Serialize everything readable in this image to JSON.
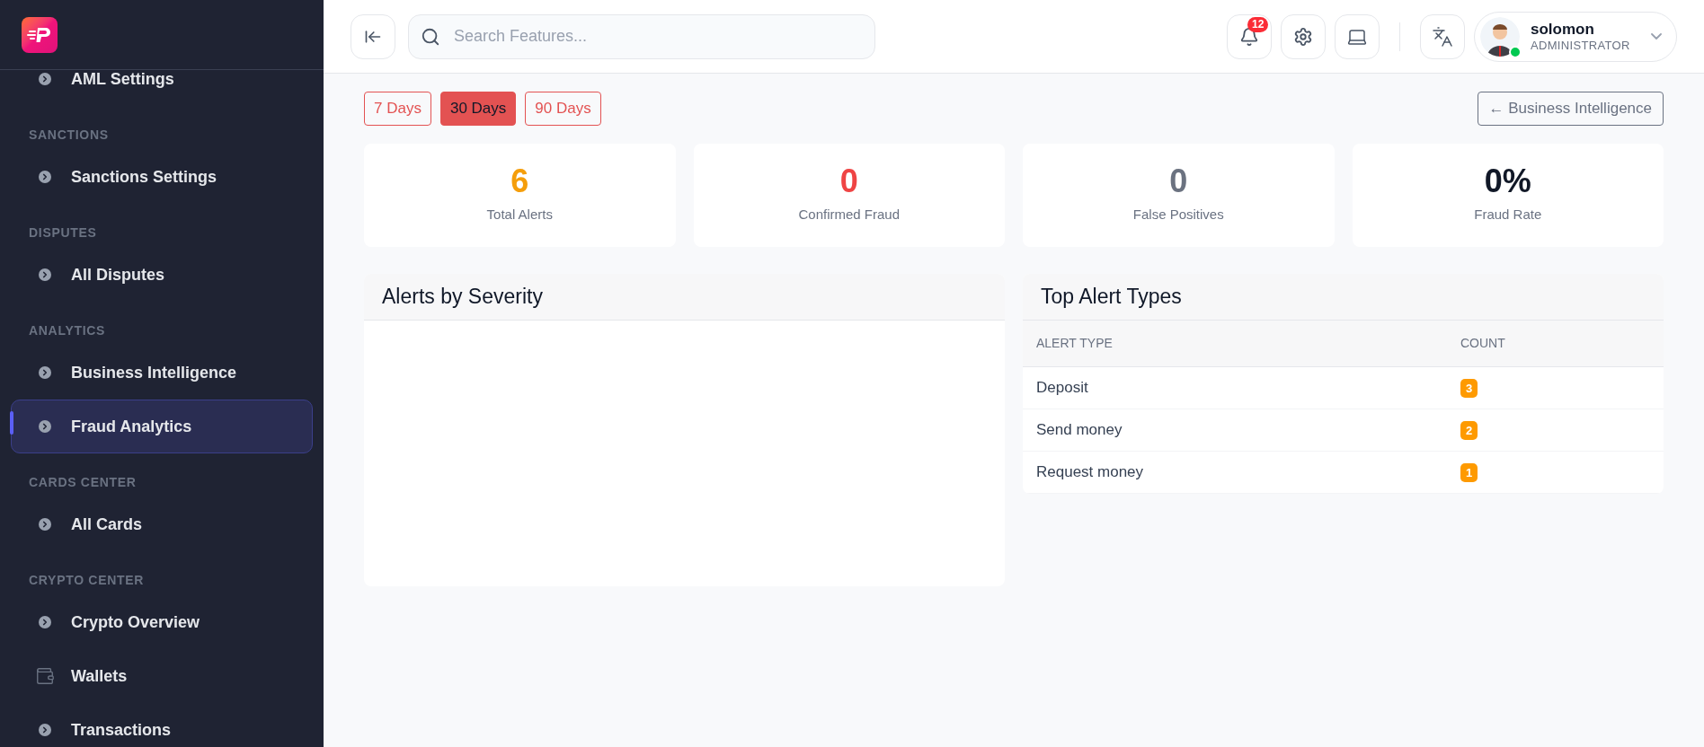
{
  "sidebar": {
    "sections": [
      {
        "items": [
          {
            "label": "AML Settings",
            "kind": "chevron",
            "selected": false
          }
        ]
      },
      {
        "heading": "SANCTIONS",
        "items": [
          {
            "label": "Sanctions Settings",
            "kind": "chevron",
            "selected": false
          }
        ]
      },
      {
        "heading": "DISPUTES",
        "items": [
          {
            "label": "All Disputes",
            "kind": "chevron",
            "selected": false
          }
        ]
      },
      {
        "heading": "ANALYTICS",
        "items": [
          {
            "label": "Business Intelligence",
            "kind": "chevron",
            "selected": false
          },
          {
            "label": "Fraud Analytics",
            "kind": "chevron",
            "selected": true
          }
        ]
      },
      {
        "heading": "CARDS CENTER",
        "items": [
          {
            "label": "All Cards",
            "kind": "chevron",
            "selected": false
          }
        ]
      },
      {
        "heading": "CRYPTO CENTER",
        "items": [
          {
            "label": "Crypto Overview",
            "kind": "chevron",
            "selected": false
          },
          {
            "label": "Wallets",
            "kind": "wallet",
            "selected": false
          },
          {
            "label": "Transactions",
            "kind": "chevron",
            "selected": false
          }
        ]
      }
    ]
  },
  "topbar": {
    "search": {
      "placeholder": "Search Features..."
    },
    "notifications": "12",
    "user": {
      "name": "solomon",
      "role": "ADMINISTRATOR",
      "online": true
    }
  },
  "filters": [
    {
      "label": "7 Days",
      "selected": false
    },
    {
      "label": "30 Days",
      "selected": true
    },
    {
      "label": "90 Days",
      "selected": false
    }
  ],
  "back_button": "← Business Intelligence",
  "stats": [
    {
      "value": "6",
      "label": "Total Alerts",
      "color": "#f59e0b"
    },
    {
      "value": "0",
      "label": "Confirmed Fraud",
      "color": "#ef4444"
    },
    {
      "value": "0",
      "label": "False Positives",
      "color": "#6b7280"
    },
    {
      "value": "0%",
      "label": "Fraud Rate",
      "color": "#111827"
    }
  ],
  "severity_panel": {
    "title": "Alerts by Severity"
  },
  "alert_types": {
    "title": "Top Alert Types",
    "columns": [
      "ALERT TYPE",
      "COUNT"
    ],
    "rows": [
      {
        "type": "Deposit",
        "count": "3"
      },
      {
        "type": "Send money",
        "count": "2"
      },
      {
        "type": "Request money",
        "count": "1"
      }
    ]
  }
}
